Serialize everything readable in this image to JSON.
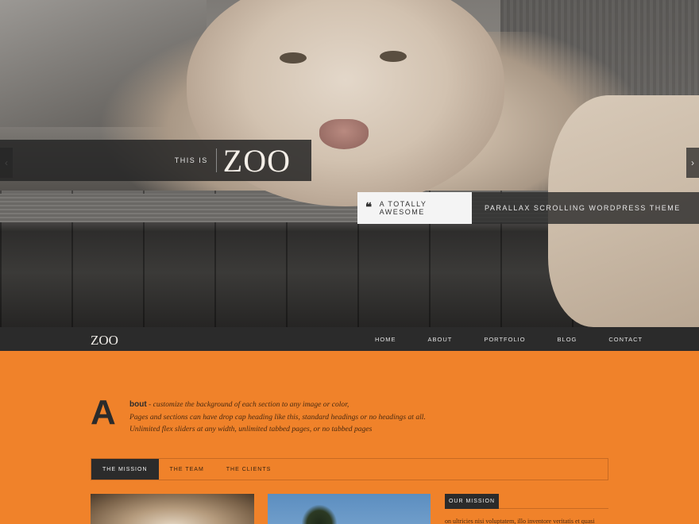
{
  "hero": {
    "title_prefix": "THIS IS",
    "title": "ZOO",
    "tagline_quote": "❝",
    "tagline_highlight": "A TOTALLY AWESOME",
    "tagline_rest": "PARALLAX SCROLLING WORDPRESS THEME",
    "prev_arrow": "‹",
    "next_arrow": "›"
  },
  "nav": {
    "logo": "ZOO",
    "items": [
      "HOME",
      "ABOUT",
      "PORTFOLIO",
      "BLOG",
      "CONTACT"
    ]
  },
  "about": {
    "dropcap": "A",
    "lead_word": "bout",
    "line1": " - customize the background of each section to any image or color,",
    "line2": "Pages and sections can have drop cap heading like this, standard headings or no headings at all.",
    "line3": "Unlimited flex sliders at any width, unlimited tabbed pages, or no tabbed pages"
  },
  "tabs": {
    "items": [
      "THE MISSION",
      "THE TEAM",
      "THE CLIENTS"
    ],
    "active": "THE MISSION"
  },
  "content": {
    "mission_label": "OUR MISSION",
    "mission_text": "on ultricies nisi voluptatem, illo inventore veritatis et quasi"
  },
  "colors": {
    "accent": "#f0822a",
    "dark": "#2b2b2b"
  }
}
